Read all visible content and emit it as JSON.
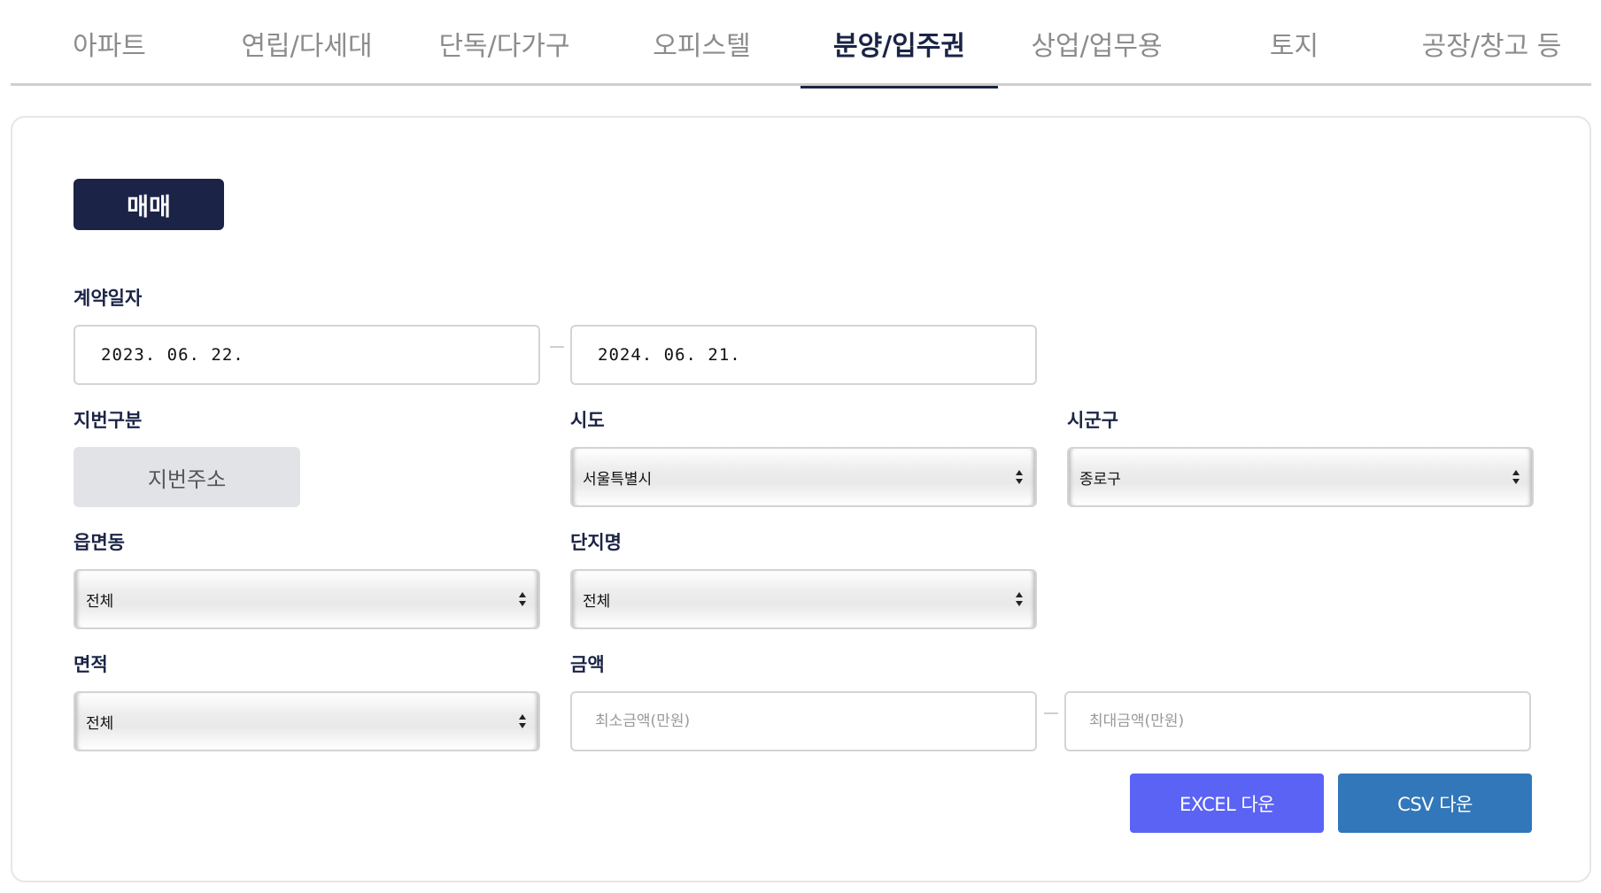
{
  "tabs": [
    {
      "label": "아파트"
    },
    {
      "label": "연립/다세대"
    },
    {
      "label": "단독/다가구"
    },
    {
      "label": "오피스텔"
    },
    {
      "label": "분양/입주권",
      "active": true
    },
    {
      "label": "상업/업무용"
    },
    {
      "label": "토지"
    },
    {
      "label": "공장/창고 등"
    }
  ],
  "trade_type": {
    "label": "매매",
    "color": "#1b2446"
  },
  "contract_date": {
    "label": "계약일자",
    "start": "2023. 06. 22.",
    "end": "2024. 06. 21."
  },
  "lot_type": {
    "label": "지번구분",
    "button": "지번주소"
  },
  "sido": {
    "label": "시도",
    "value": "서울특별시"
  },
  "sigungu": {
    "label": "시군구",
    "value": "종로구"
  },
  "eupmyeondong": {
    "label": "읍면동",
    "value": "전체"
  },
  "complex": {
    "label": "단지명",
    "value": "전체"
  },
  "area": {
    "label": "면적",
    "value": "전체"
  },
  "amount": {
    "label": "금액",
    "min_placeholder": "최소금액(만원)",
    "max_placeholder": "최대금액(만원)"
  },
  "actions": {
    "excel": {
      "label": "EXCEL 다운",
      "color": "#5b63f5"
    },
    "csv": {
      "label": "CSV 다운",
      "color": "#3277b9"
    }
  }
}
